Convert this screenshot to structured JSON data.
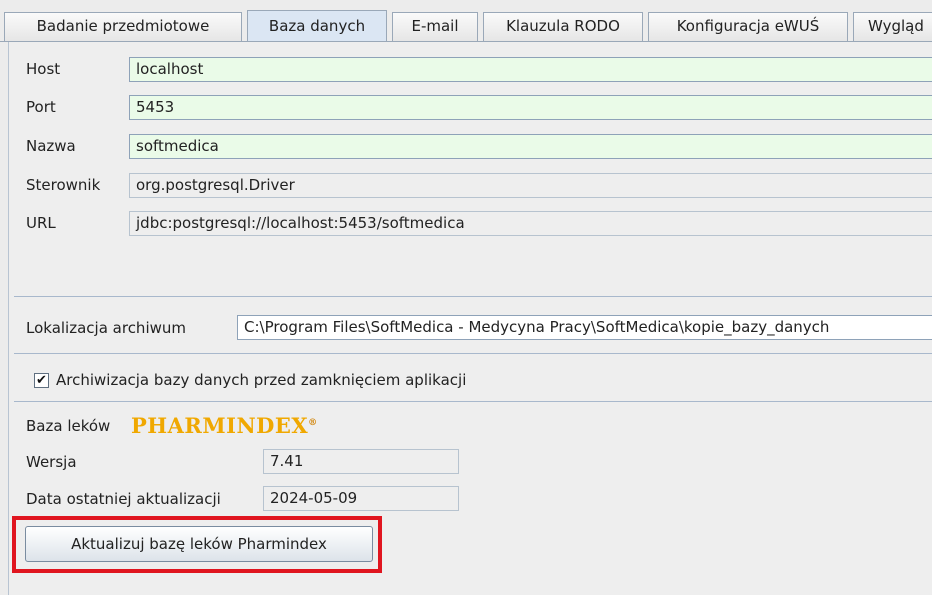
{
  "tabs": [
    "Badanie przedmiotowe",
    "Baza danych",
    "E-mail",
    "Klauzula RODO",
    "Konfiguracja eWUŚ",
    "Wygląd"
  ],
  "db": {
    "host_label": "Host",
    "host_value": "localhost",
    "port_label": "Port",
    "port_value": "5453",
    "name_label": "Nazwa",
    "name_value": "softmedica",
    "driver_label": "Sterownik",
    "driver_value": "org.postgresql.Driver",
    "url_label": "URL",
    "url_value": "jdbc:postgresql://localhost:5453/softmedica"
  },
  "archive": {
    "location_label": "Lokalizacja archiwum",
    "location_value": "C:\\Program Files\\SoftMedica - Medycyna Pracy\\SoftMedica\\kopie_bazy_danych",
    "checkbox_label": "Archiwizacja bazy danych przed zamknięciem aplikacji",
    "checkbox_checked": true
  },
  "drugs": {
    "section_label": "Baza leków",
    "logo_text": "PHARMINDEX",
    "logo_mark": "®",
    "version_label": "Wersja",
    "version_value": "7.41",
    "update_label": "Data ostatniej aktualizacji",
    "update_value": "2024-05-09",
    "update_button": "Aktualizuj bazę leków Pharmindex"
  },
  "colors": {
    "highlight": "#e0151f",
    "editable_field": "#eafbe8",
    "logo": "#f0a800"
  }
}
